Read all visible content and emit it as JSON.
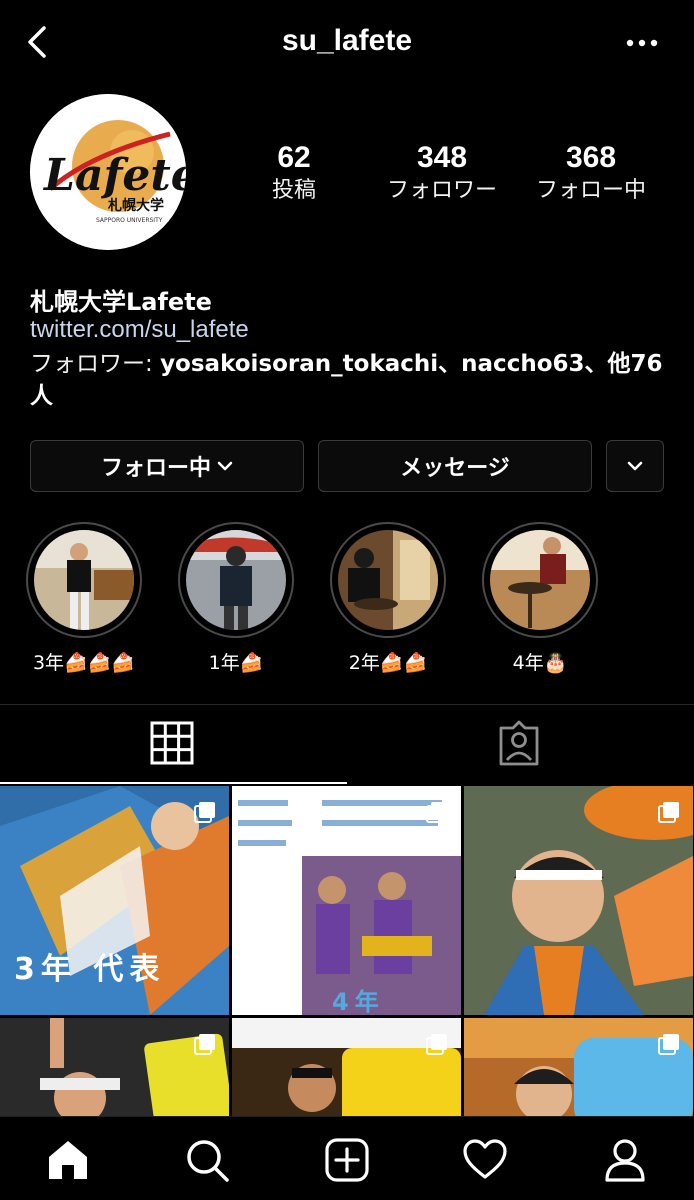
{
  "header": {
    "username": "su_lafete"
  },
  "profile": {
    "stats": [
      {
        "value": "62",
        "label": "投稿"
      },
      {
        "value": "348",
        "label": "フォロワー"
      },
      {
        "value": "368",
        "label": "フォロー中"
      }
    ],
    "avatar_logo_text": "Lafete",
    "avatar_logo_sub": "札幌大学",
    "avatar_logo_sub2": "SAPPORO UNIVERSITY"
  },
  "bio": {
    "name": "札幌大学Lafete",
    "link": "twitter.com/su_lafete",
    "followed_by_prefix": "フォロワー: ",
    "followed_by_names": "yosakoisoran_tokachi、naccho63、他76人"
  },
  "buttons": {
    "following": "フォロー中",
    "message": "メッセージ"
  },
  "highlights": [
    {
      "label": "3年🍰🍰🍰"
    },
    {
      "label": "1年🍰"
    },
    {
      "label": "2年🍰🍰"
    },
    {
      "label": "4年🎂"
    }
  ],
  "grid_posts": [
    {
      "caption": "3年 代表"
    },
    {
      "caption": "4年"
    },
    {
      "caption": ""
    },
    {
      "caption": ""
    },
    {
      "caption": ""
    },
    {
      "caption": ""
    }
  ],
  "colors": {
    "background": "#000000",
    "link": "#c7d5ea",
    "border": "#3a3a3a"
  },
  "icons": [
    "back-icon",
    "more-icon",
    "chevron-down-icon",
    "grid-icon",
    "tagged-icon",
    "home-icon",
    "search-icon",
    "add-icon",
    "heart-icon",
    "profile-icon"
  ]
}
